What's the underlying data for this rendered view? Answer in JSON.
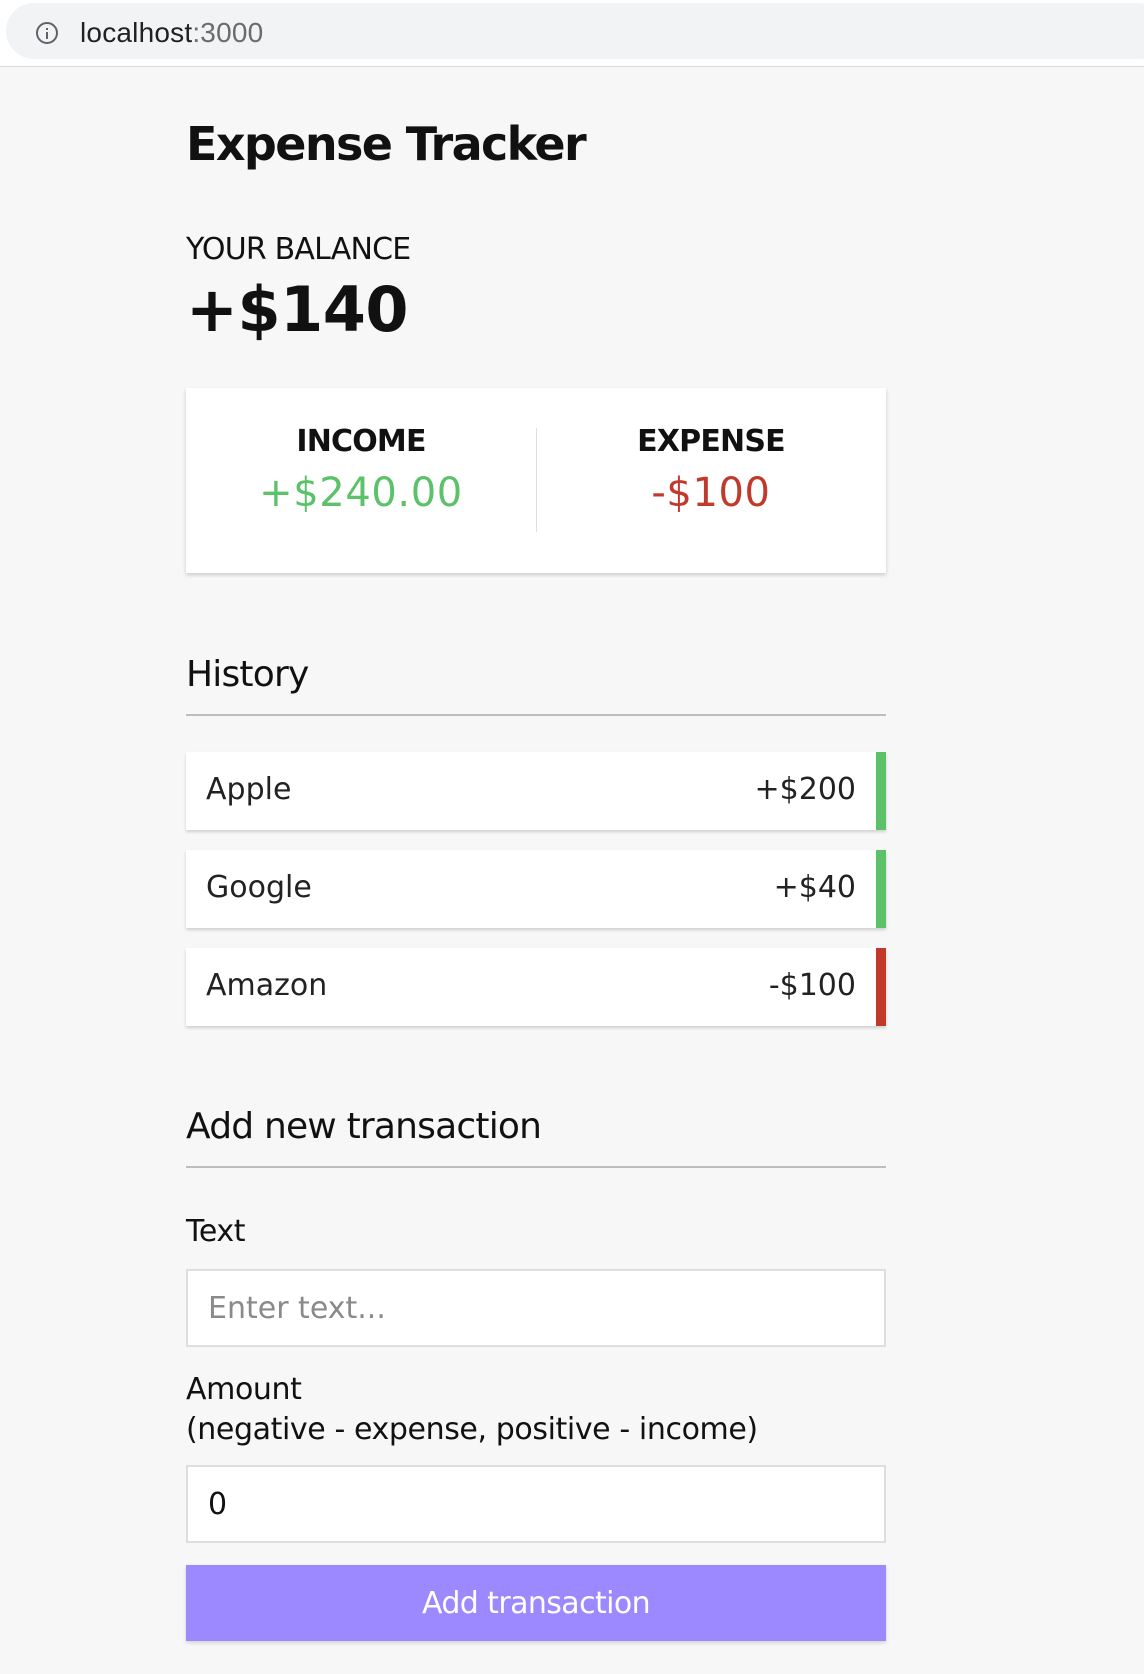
{
  "browser": {
    "url_host": "localhost",
    "url_port": ":3000",
    "info_icon": "info-icon"
  },
  "app": {
    "title": "Expense Tracker"
  },
  "balance": {
    "label": "YOUR BALANCE",
    "value": "+$140"
  },
  "summary": {
    "income_label": "INCOME",
    "income_value": "+$240.00",
    "expense_label": "EXPENSE",
    "expense_value": "-$100",
    "income_color": "#5cc26a",
    "expense_color": "#c0392b"
  },
  "history": {
    "title": "History",
    "items": [
      {
        "text": "Apple",
        "amount": "+$200",
        "type": "plus"
      },
      {
        "text": "Google",
        "amount": "+$40",
        "type": "plus"
      },
      {
        "text": "Amazon",
        "amount": "-$100",
        "type": "minus"
      }
    ]
  },
  "form": {
    "title": "Add new transaction",
    "text_label": "Text",
    "text_placeholder": "Enter text...",
    "text_value": "",
    "amount_label": "Amount",
    "amount_hint": "(negative - expense, positive - income)",
    "amount_value": "0",
    "submit_label": "Add transaction",
    "submit_color": "#9c88ff"
  }
}
